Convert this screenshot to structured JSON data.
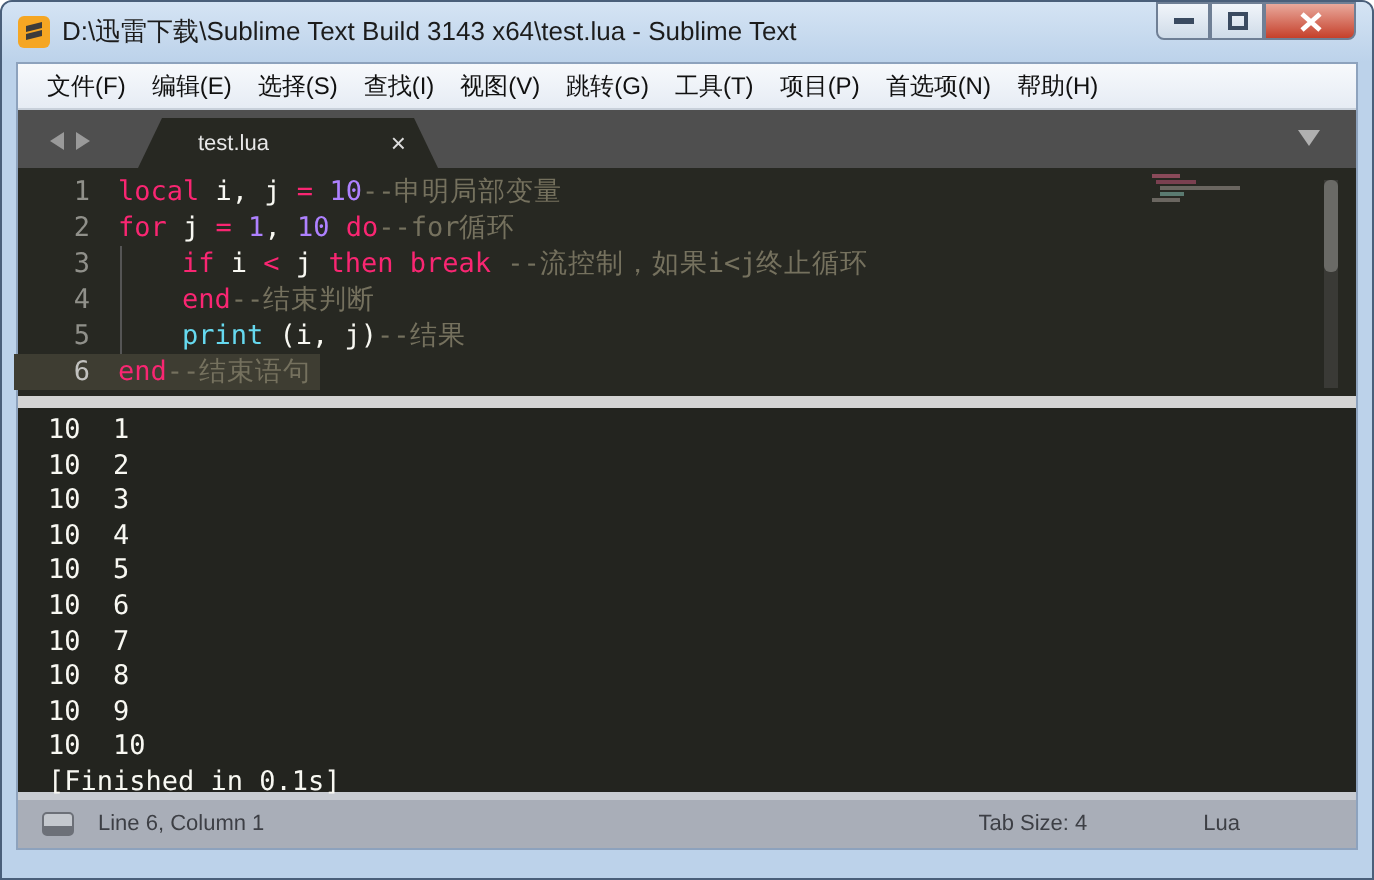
{
  "window": {
    "title": "D:\\迅雷下载\\Sublime Text Build 3143 x64\\test.lua - Sublime Text"
  },
  "menu": [
    "文件(F)",
    "编辑(E)",
    "选择(S)",
    "查找(I)",
    "视图(V)",
    "跳转(G)",
    "工具(T)",
    "项目(P)",
    "首选项(N)",
    "帮助(H)"
  ],
  "tabs": [
    {
      "label": "test.lua",
      "selected": true,
      "close": "×"
    }
  ],
  "editor": {
    "lines": [
      {
        "number": "1",
        "indented": false,
        "current": false,
        "tokens": [
          {
            "kind": "keyword",
            "text": "local"
          },
          {
            "kind": "plain",
            "text": " i, j "
          },
          {
            "kind": "operator",
            "text": "="
          },
          {
            "kind": "number",
            "text": " 10"
          },
          {
            "kind": "comment",
            "text": "--申明局部变量"
          }
        ]
      },
      {
        "number": "2",
        "indented": false,
        "current": false,
        "tokens": [
          {
            "kind": "keyword",
            "text": "for"
          },
          {
            "kind": "plain",
            "text": " j "
          },
          {
            "kind": "operator",
            "text": "="
          },
          {
            "kind": "number",
            "text": " 1"
          },
          {
            "kind": "plain",
            "text": ", "
          },
          {
            "kind": "number",
            "text": "10"
          },
          {
            "kind": "keyword",
            "text": " do"
          },
          {
            "kind": "comment",
            "text": "--for循环"
          }
        ]
      },
      {
        "number": "3",
        "indented": true,
        "current": false,
        "tokens": [
          {
            "kind": "keyword",
            "text": "if"
          },
          {
            "kind": "plain",
            "text": " i "
          },
          {
            "kind": "operator",
            "text": "<"
          },
          {
            "kind": "plain",
            "text": " j "
          },
          {
            "kind": "keyword",
            "text": "then break"
          },
          {
            "kind": "comment",
            "text": " --流控制，如果i<j终止循环"
          }
        ]
      },
      {
        "number": "4",
        "indented": true,
        "current": false,
        "tokens": [
          {
            "kind": "keyword",
            "text": "end"
          },
          {
            "kind": "comment",
            "text": "--结束判断"
          }
        ]
      },
      {
        "number": "5",
        "indented": true,
        "current": false,
        "tokens": [
          {
            "kind": "builtin",
            "text": "print"
          },
          {
            "kind": "plain",
            "text": " (i, j)"
          },
          {
            "kind": "comment",
            "text": "--结果"
          }
        ]
      },
      {
        "number": "6",
        "indented": false,
        "current": true,
        "tokens": [
          {
            "kind": "keyword",
            "text": "end"
          },
          {
            "kind": "comment",
            "text": "--结束语句"
          }
        ]
      }
    ]
  },
  "output": {
    "lines": [
      "10  1",
      "10  2",
      "10  3",
      "10  4",
      "10  5",
      "10  6",
      "10  7",
      "10  8",
      "10  9",
      "10  10",
      "[Finished in 0.1s]"
    ]
  },
  "status_bar": {
    "position": "Line 6, Column 1",
    "tab_size": "Tab Size: 4",
    "syntax": "Lua"
  }
}
